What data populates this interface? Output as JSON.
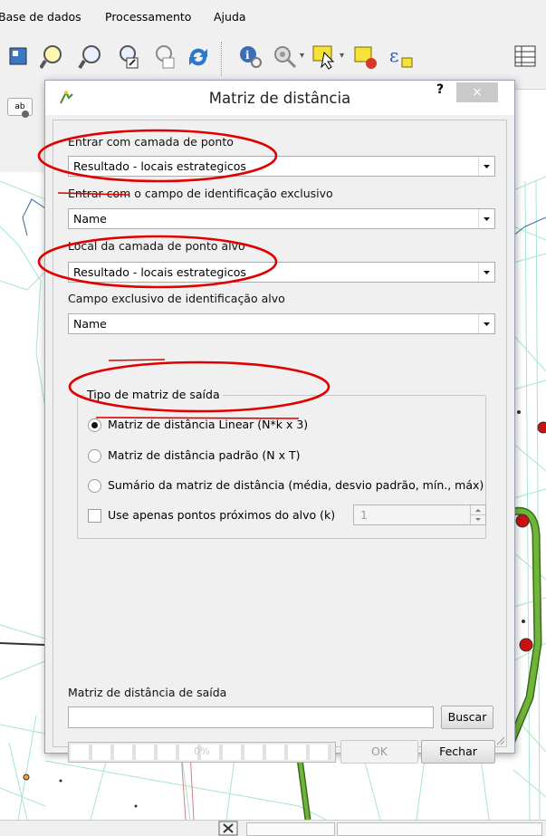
{
  "menubar": {
    "items": [
      "Base de dados",
      "Processamento",
      "Ajuda"
    ]
  },
  "left_panel": {
    "label": "ab"
  },
  "toolbar": {
    "icons": [
      "pan-to-selection-icon",
      "zoom-in-icon",
      "zoom-out-icon",
      "zoom-to-layer-icon",
      "zoom-to-selection-icon",
      "refresh-icon",
      "identify-icon",
      "run-feature-action-icon",
      "select-features-icon",
      "deselect-icon",
      "expression-select-icon",
      "attribute-table-icon"
    ]
  },
  "dialog": {
    "title": "Matriz de distância",
    "help_label": "?",
    "close_label": "×",
    "input_layer_label": "Entrar com camada de ponto",
    "input_layer_value": "Resultado - locais estrategicos",
    "id_field_label": "Entrar com o campo de identificação exclusivo",
    "id_field_value": "Name",
    "target_layer_label": "Local da camada de ponto alvo",
    "target_layer_value": "Resultado - locais estrategicos",
    "target_field_label": "Campo exclusivo de identificação alvo",
    "target_field_value": "Name",
    "matrix_group_label": "Tipo de matriz de saída",
    "radio_linear": "Matriz de distância Linear (N*k x 3)",
    "radio_standard": "Matriz de distância padrão (N x T)",
    "radio_summary": "Sumário da matriz de distância (média, desvio padrão, mín., máx)",
    "nearest_label": "Use apenas pontos próximos do alvo (k)",
    "nearest_value": "1",
    "output_label": "Matriz de distância de saída",
    "output_value": "",
    "browse_label": "Buscar",
    "progress_text": "0%",
    "ok_label": "OK",
    "close_button_label": "Fechar"
  },
  "colors": {
    "annotation": "#e00000",
    "dialog_bg": "#f0f0f0",
    "map_lines": "#9fe0c8",
    "road": "#5aa02c",
    "point": "#cc1111"
  }
}
